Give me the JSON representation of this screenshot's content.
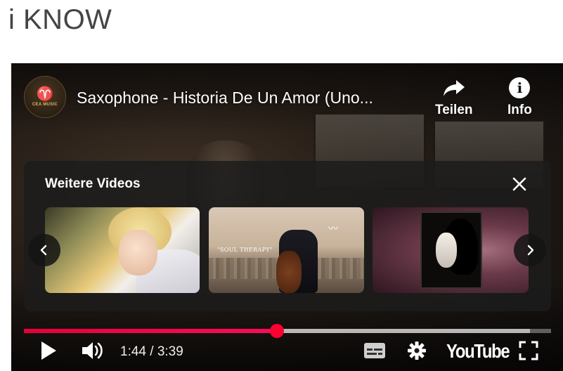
{
  "page": {
    "heading": "i KNOW"
  },
  "player": {
    "channel": {
      "avatar_label": "CEA MUSIC"
    },
    "title": "Saxophone - Historia De Un Amor (Uno...",
    "actions": [
      {
        "label": "Teilen",
        "icon": "share-arrow-icon"
      },
      {
        "label": "Info",
        "icon": "info-icon"
      }
    ],
    "more_videos": {
      "title": "Weitere Videos",
      "thumbnails": [
        {
          "icon": "blonde-woman-portrait"
        },
        {
          "icon": "cellist-city-skyline",
          "caption": "\"SOUL THERAPY\""
        },
        {
          "icon": "woman-profile-portrait"
        }
      ]
    },
    "progress": {
      "played_fraction": 0.48,
      "loaded_fraction": 0.96,
      "accent": "#ff0033"
    },
    "controls": {
      "time": "1:44 / 3:39",
      "logo": "YouTube"
    }
  }
}
